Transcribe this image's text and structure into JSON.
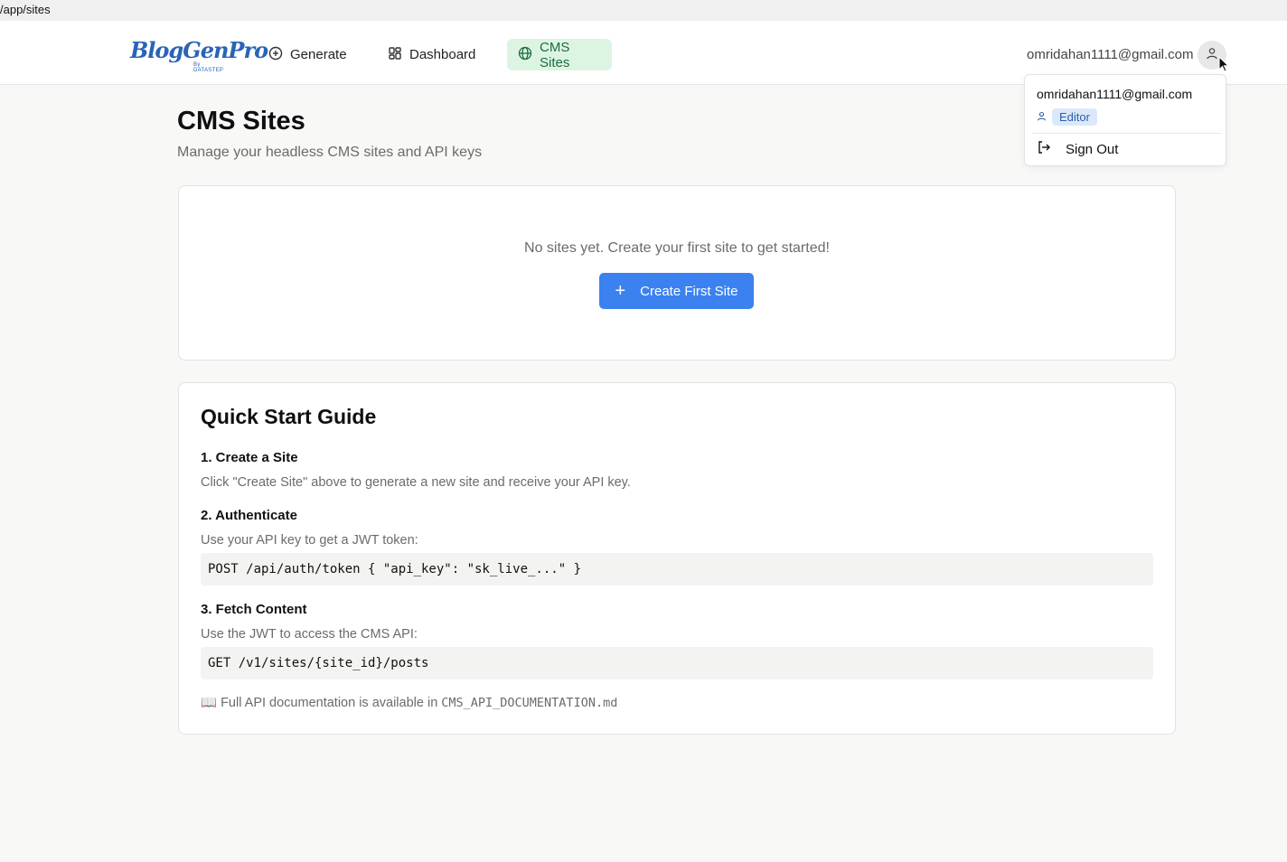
{
  "browser": {
    "url": "/app/sites"
  },
  "nav": {
    "logo_text": "BlogGenPro",
    "logo_sub": "By DATASTEP",
    "items": [
      {
        "label": "Generate",
        "icon": "plus-circle-icon"
      },
      {
        "label": "Dashboard",
        "icon": "dashboard-grid-icon"
      },
      {
        "label": "CMS Sites",
        "icon": "globe-icon",
        "active": true
      }
    ],
    "user_email": "omridahan1111@gmail.com"
  },
  "user_menu": {
    "email": "omridahan1111@gmail.com",
    "role": "Editor",
    "sign_out_label": "Sign Out"
  },
  "page": {
    "title": "CMS Sites",
    "subtitle": "Manage your headless CMS sites and API keys"
  },
  "empty_state": {
    "message": "No sites yet. Create your first site to get started!",
    "button_label": "Create First Site"
  },
  "guide": {
    "title": "Quick Start Guide",
    "steps": [
      {
        "title": "1. Create a Site",
        "desc": "Click \"Create Site\" above to generate a new site and receive your API key.",
        "code": ""
      },
      {
        "title": "2. Authenticate",
        "desc": "Use your API key to get a JWT token:",
        "code": "POST /api/auth/token { \"api_key\": \"sk_live_...\" }"
      },
      {
        "title": "3. Fetch Content",
        "desc": "Use the JWT to access the CMS API:",
        "code": "GET /v1/sites/{site_id}/posts"
      }
    ],
    "doc_emoji": "📖",
    "doc_text": "Full API documentation is available in",
    "doc_file": "CMS_API_DOCUMENTATION.md"
  },
  "colors": {
    "accent": "#3b82f0",
    "active_nav_bg": "#dcf5e3",
    "role_badge_bg": "#dbe8fb"
  }
}
